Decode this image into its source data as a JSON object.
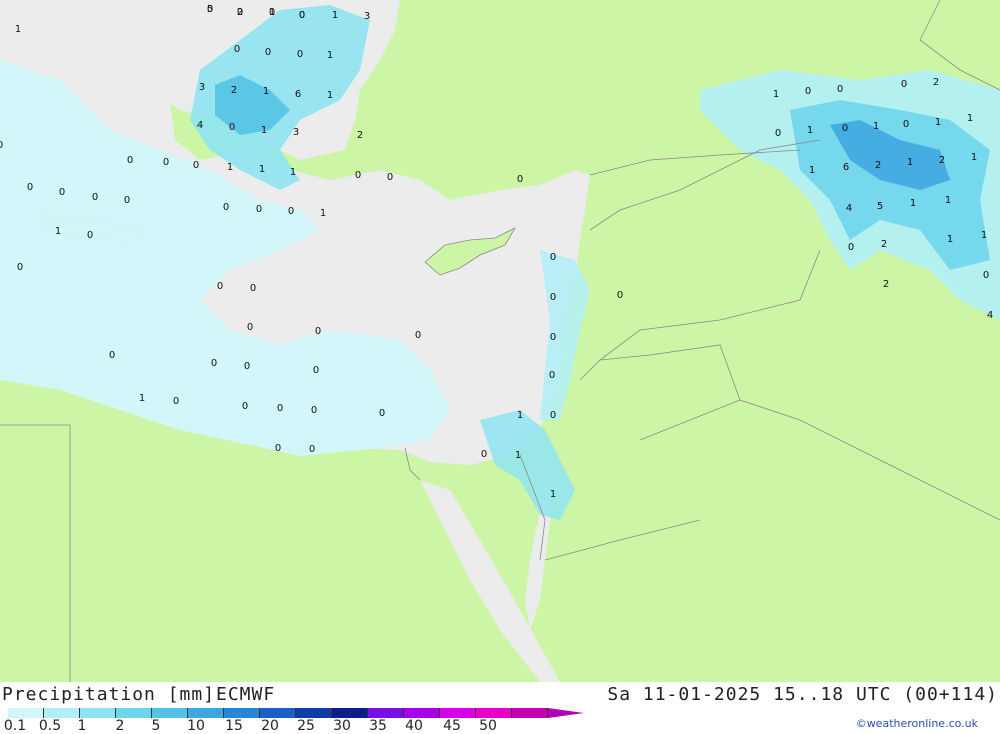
{
  "header": {
    "title": "Precipitation [mm]",
    "model": "ECMWF",
    "validity": "Sa 11-01-2025 15..18 UTC (00+114)"
  },
  "credit": "©weatheronline.co.uk",
  "colors": {
    "land": "#ccf5a6",
    "sea": "#ececec",
    "border": "#8a8a8a"
  },
  "legend": {
    "labels": [
      "0.1",
      "0.5",
      "1",
      "2",
      "5",
      "10",
      "15",
      "20",
      "25",
      "30",
      "35",
      "40",
      "45",
      "50"
    ],
    "colors": [
      "#d2f7fb",
      "#b1eff8",
      "#8fe4f2",
      "#6fd5ec",
      "#55c2e6",
      "#3ea6e0",
      "#2a84d8",
      "#1c5fc8",
      "#0f3ca8",
      "#0a1f8c",
      "#7a10e8",
      "#a800e8",
      "#d800e8",
      "#e800c8",
      "#c400b0"
    ],
    "arrow_color": "#b400b4"
  },
  "values": [
    "0",
    "2",
    "0",
    "0",
    "1",
    "3",
    "1",
    "0",
    "0",
    "0",
    "1",
    "3",
    "2",
    "1",
    "6",
    "1",
    "4",
    "0",
    "1",
    "3",
    "2",
    "0",
    "0",
    "0",
    "0",
    "1",
    "1",
    "1",
    "0",
    "0",
    "0",
    "0",
    "0",
    "0",
    "0",
    "0",
    "0",
    "1",
    "0",
    "1",
    "0",
    "0",
    "0",
    "0",
    "0",
    "0",
    "0",
    "0",
    "0",
    "0",
    "0",
    "0",
    "0",
    "0",
    "1",
    "0",
    "0",
    "0",
    "0",
    "0",
    "0",
    "0",
    "0",
    "0",
    "0",
    "0",
    "1",
    "1",
    "1",
    "0",
    "1",
    "0",
    "1",
    "0",
    "1",
    "1",
    "1",
    "0",
    "0",
    "1",
    "6",
    "2",
    "1",
    "2",
    "1",
    "1",
    "1",
    "5",
    "4",
    "2",
    "2",
    "0",
    "0",
    "2",
    "1",
    "1",
    "0",
    "4",
    "5",
    "0",
    "1",
    "0"
  ]
}
